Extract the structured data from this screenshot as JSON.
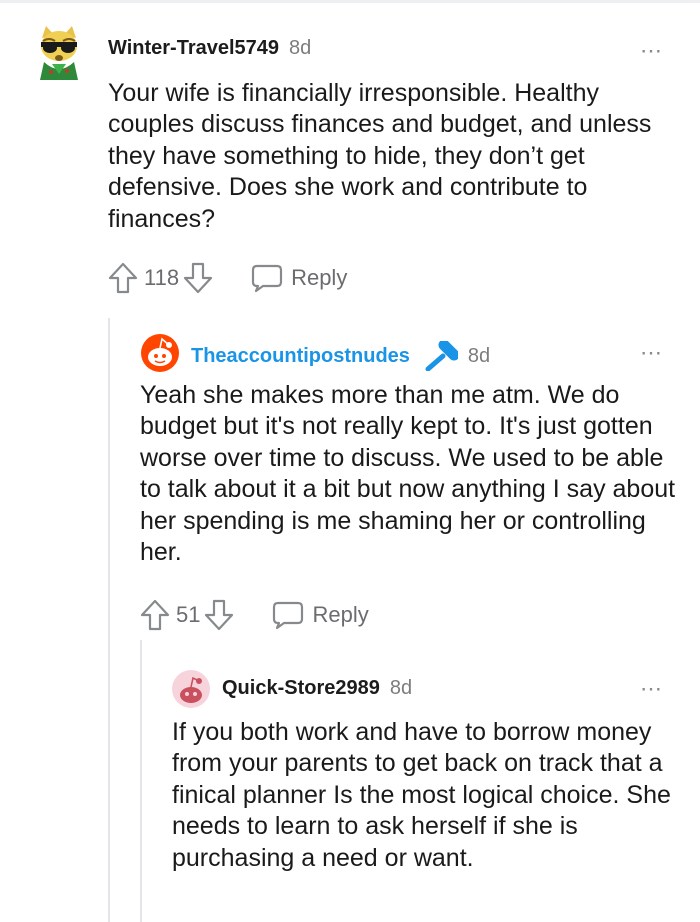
{
  "comments": [
    {
      "username": "Winter-Travel5749",
      "time": "8d",
      "body": "Your wife is financially irresponsible. Healthy couples discuss finances and budget, and unless they have something to hide, they don’t get defensive. Does she work and contribute to finances?",
      "score": "118",
      "reply_label": "Reply",
      "avatar_icon": "cat-avatar-icon"
    },
    {
      "username": "Theaccountipostnudes",
      "time": "8d",
      "body": "Yeah she makes more than me atm. We do budget but it's not really kept to. It's just gotten worse over time to discuss. We used to be able to talk about it a bit but now anything I say about her spending is me shaming her or controlling her.",
      "score": "51",
      "reply_label": "Reply",
      "avatar_icon": "snoo-avatar-icon",
      "op_icon": "microphone-icon",
      "accent_color": "#1a94e6"
    },
    {
      "username": "Quick-Store2989",
      "time": "8d",
      "body": "If you both work and have to borrow money from your parents to get back on track that a finical planner Is the most logical choice. She needs to learn to ask herself if she is purchasing a need or want.",
      "avatar_icon": "snoo-avatar-icon"
    }
  ],
  "more_icon": "⋯"
}
